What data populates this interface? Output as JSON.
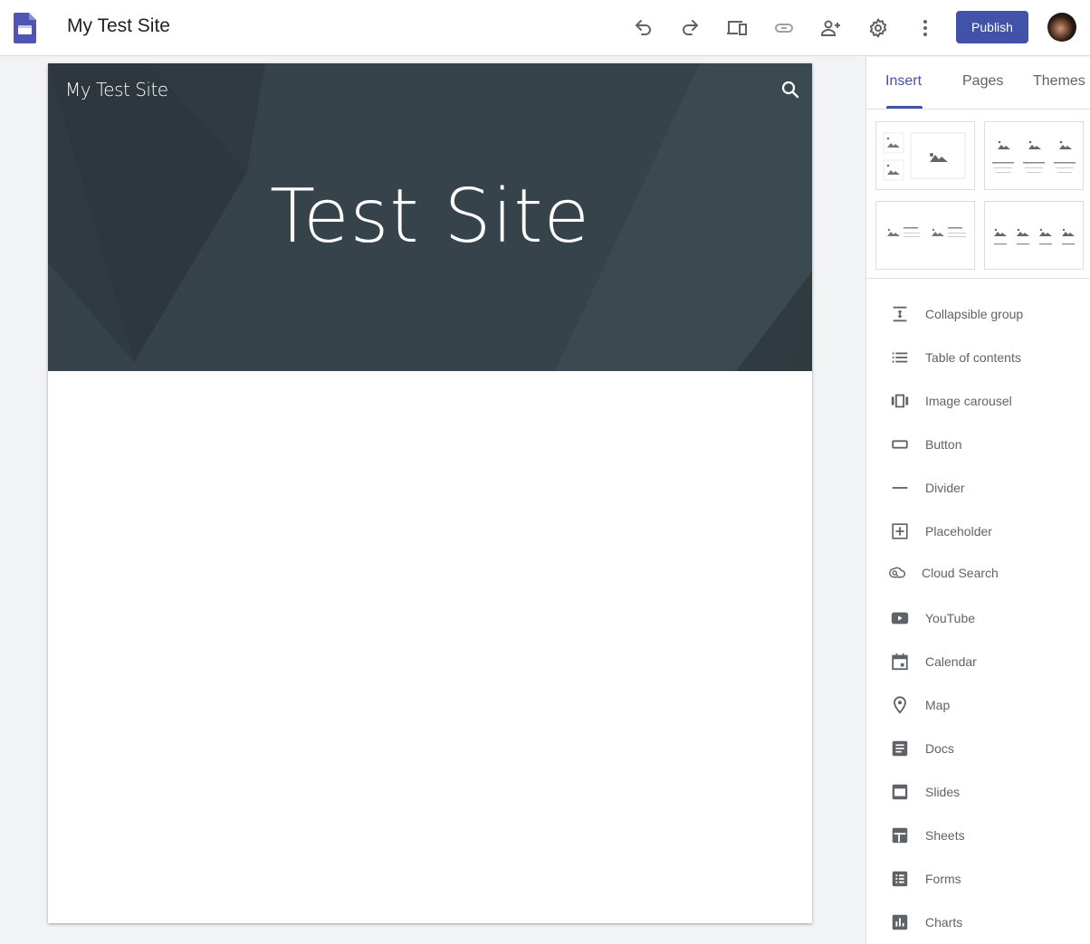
{
  "app": {
    "title": "My Test Site",
    "accent_color": "#4152a8"
  },
  "toolbar": {
    "icons": [
      "undo-icon",
      "redo-icon",
      "preview-devices-icon",
      "link-icon",
      "share-person-add-icon",
      "settings-gear-icon",
      "more-vert-icon"
    ],
    "publish_label": "Publish"
  },
  "site": {
    "header_name": "My Test Site",
    "hero_title": "Test Site",
    "hero_bg_color": "#36434a"
  },
  "panel": {
    "tabs": [
      {
        "label": "Insert",
        "active": true
      },
      {
        "label": "Pages",
        "active": false
      },
      {
        "label": "Themes",
        "active": false
      }
    ],
    "layouts": [
      "layout-two-small-one-large",
      "layout-three-columns-text",
      "layout-two-image-text",
      "layout-four-columns"
    ],
    "items": [
      {
        "label": "Collapsible group",
        "icon": "collapsible-group-icon"
      },
      {
        "label": "Table of contents",
        "icon": "table-of-contents-icon"
      },
      {
        "label": "Image carousel",
        "icon": "image-carousel-icon"
      },
      {
        "label": "Button",
        "icon": "button-icon"
      },
      {
        "label": "Divider",
        "icon": "divider-icon"
      },
      {
        "label": "Placeholder",
        "icon": "placeholder-icon"
      },
      {
        "label": "Cloud Search",
        "icon": "cloud-search-icon"
      },
      {
        "label": "YouTube",
        "icon": "youtube-icon"
      },
      {
        "label": "Calendar",
        "icon": "calendar-icon"
      },
      {
        "label": "Map",
        "icon": "map-pin-icon"
      },
      {
        "label": "Docs",
        "icon": "docs-icon"
      },
      {
        "label": "Slides",
        "icon": "slides-icon"
      },
      {
        "label": "Sheets",
        "icon": "sheets-icon"
      },
      {
        "label": "Forms",
        "icon": "forms-icon"
      },
      {
        "label": "Charts",
        "icon": "charts-icon"
      }
    ]
  }
}
